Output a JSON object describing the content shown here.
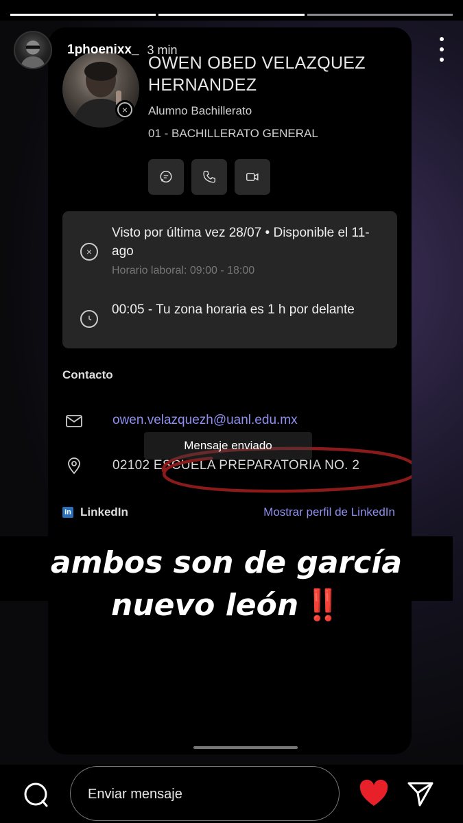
{
  "story": {
    "username": "1phoenixx_",
    "time_ago": "3 min",
    "segments": 3,
    "active_segment": 2
  },
  "profile": {
    "name": "OWEN OBED VELAZQUEZ HERNANDEZ",
    "role": "Alumno Bachillerato",
    "program": "01 - BACHILLERATO GENERAL"
  },
  "status_card": {
    "last_seen": "Visto por última vez 28/07 • Disponible el 11-ago",
    "work_hours": "Horario laboral: 09:00 - 18:00",
    "timezone": "00:05 - Tu zona horaria es 1  h por delante"
  },
  "contact": {
    "title": "Contacto",
    "email": "owen.velazquezh@uanl.edu.mx",
    "toast": "Mensaje enviado",
    "address": "02102  ESCUELA PREPARATORIA NO. 2",
    "linkedin_label": "LinkedIn",
    "linkedin_link": "Mostrar perfil de LinkedIn"
  },
  "caption": {
    "line1": "ambos son de garcía",
    "line2": "nuevo león",
    "emoji": "‼️"
  },
  "bottom": {
    "message_placeholder": "Enviar mensaje"
  },
  "colors": {
    "link": "#8f8ff0",
    "heart": "#e8202a",
    "annotation_circle": "#8b1a1a"
  },
  "icons": [
    "more-icon",
    "close-circle-icon",
    "chat-icon",
    "phone-icon",
    "video-icon",
    "clock-icon",
    "mail-icon",
    "location-icon",
    "linkedin-icon",
    "camera-icon",
    "heart-icon",
    "send-icon"
  ]
}
